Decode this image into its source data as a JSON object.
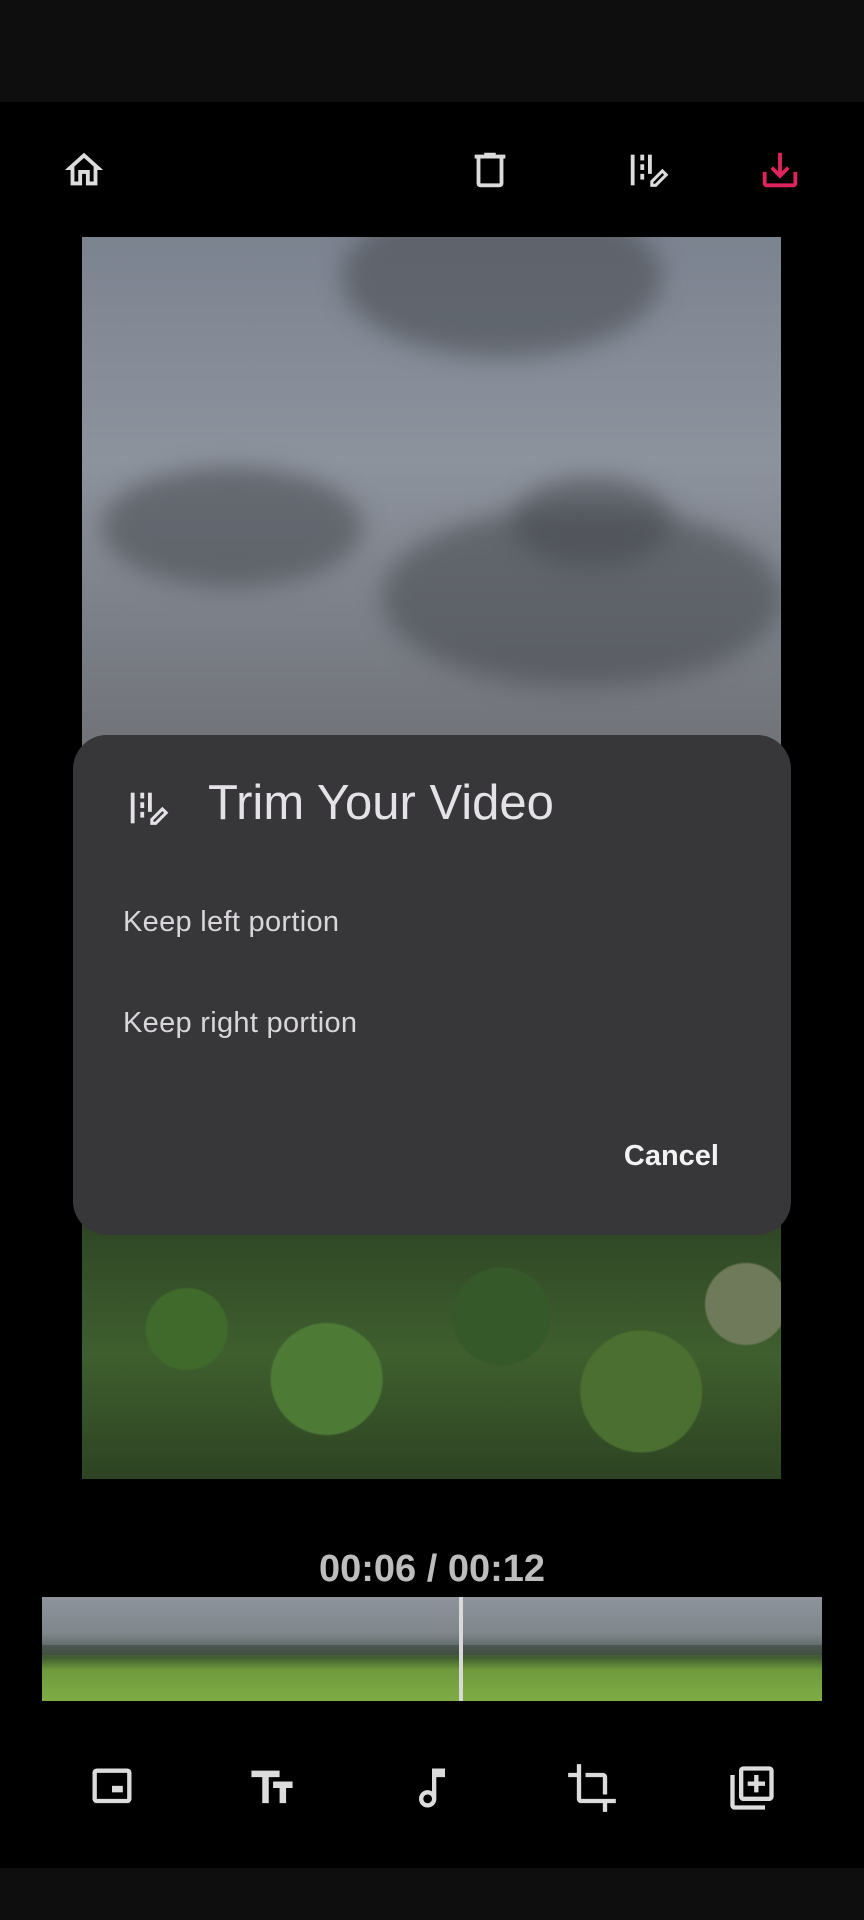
{
  "toolbar": {
    "home_icon": "home-icon",
    "delete_icon": "trash-icon",
    "trim_icon": "trim-icon",
    "download_icon": "download-icon",
    "accent_color": "#e0245e"
  },
  "dialog": {
    "title": "Trim Your Video",
    "options": [
      "Keep left portion",
      "Keep right portion"
    ],
    "cancel_label": "Cancel"
  },
  "player": {
    "time_readout": "00:06 / 00:12",
    "playhead_progress": 0.5
  },
  "bottom_tools": [
    "aspect-ratio-icon",
    "text-icon",
    "music-icon",
    "crop-icon",
    "add-clip-icon"
  ]
}
